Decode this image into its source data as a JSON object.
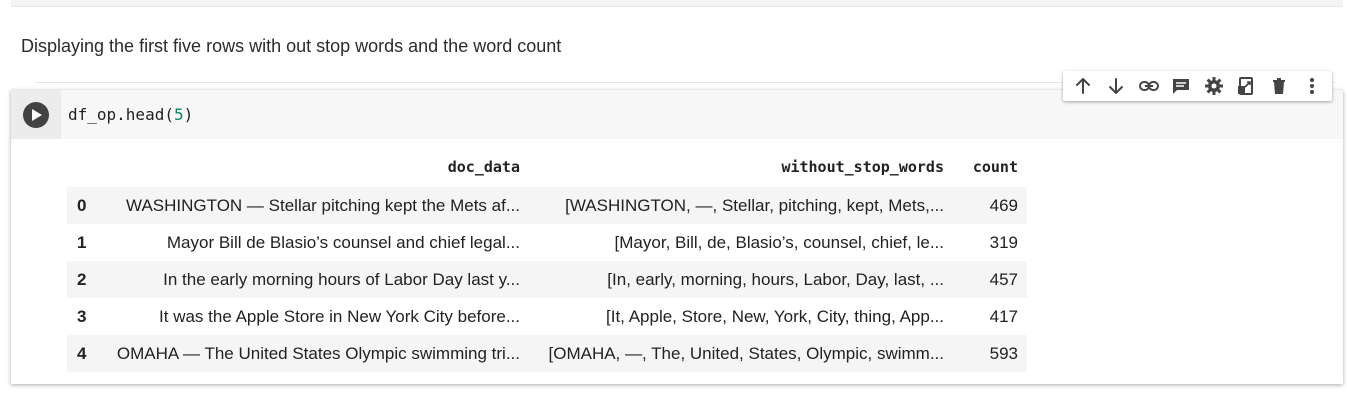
{
  "markdown": {
    "text": "Displaying the first five rows with out stop words and the word count"
  },
  "code_cell": {
    "code_prefix": "df_op.head(",
    "code_arg": "5",
    "code_suffix": ")"
  },
  "toolbar": {
    "icons": [
      "arrow-up-icon",
      "arrow-down-icon",
      "link-icon",
      "comment-icon",
      "gear-icon",
      "mirror-cell-icon",
      "trash-icon",
      "more-vert-icon"
    ]
  },
  "dataframe": {
    "columns": [
      "",
      "doc_data",
      "without_stop_words",
      "count"
    ],
    "rows": [
      {
        "index": "0",
        "doc_data": "WASHINGTON — Stellar pitching kept the Mets af...",
        "without_stop_words": "[WASHINGTON, —, Stellar, pitching, kept, Mets,...",
        "count": "469"
      },
      {
        "index": "1",
        "doc_data": "Mayor Bill de Blasio’s counsel and chief legal...",
        "without_stop_words": "[Mayor, Bill, de, Blasio’s, counsel, chief, le...",
        "count": "319"
      },
      {
        "index": "2",
        "doc_data": "In the early morning hours of Labor Day last y...",
        "without_stop_words": "[In, early, morning, hours, Labor, Day, last, ...",
        "count": "457"
      },
      {
        "index": "3",
        "doc_data": "It was the Apple Store in New York City before...",
        "without_stop_words": "[It, Apple, Store, New, York, City, thing, App...",
        "count": "417"
      },
      {
        "index": "4",
        "doc_data": "OMAHA — The United States Olympic swimming tri...",
        "without_stop_words": "[OMAHA, —, The, United, States, Olympic, swimm...",
        "count": "593"
      }
    ]
  }
}
